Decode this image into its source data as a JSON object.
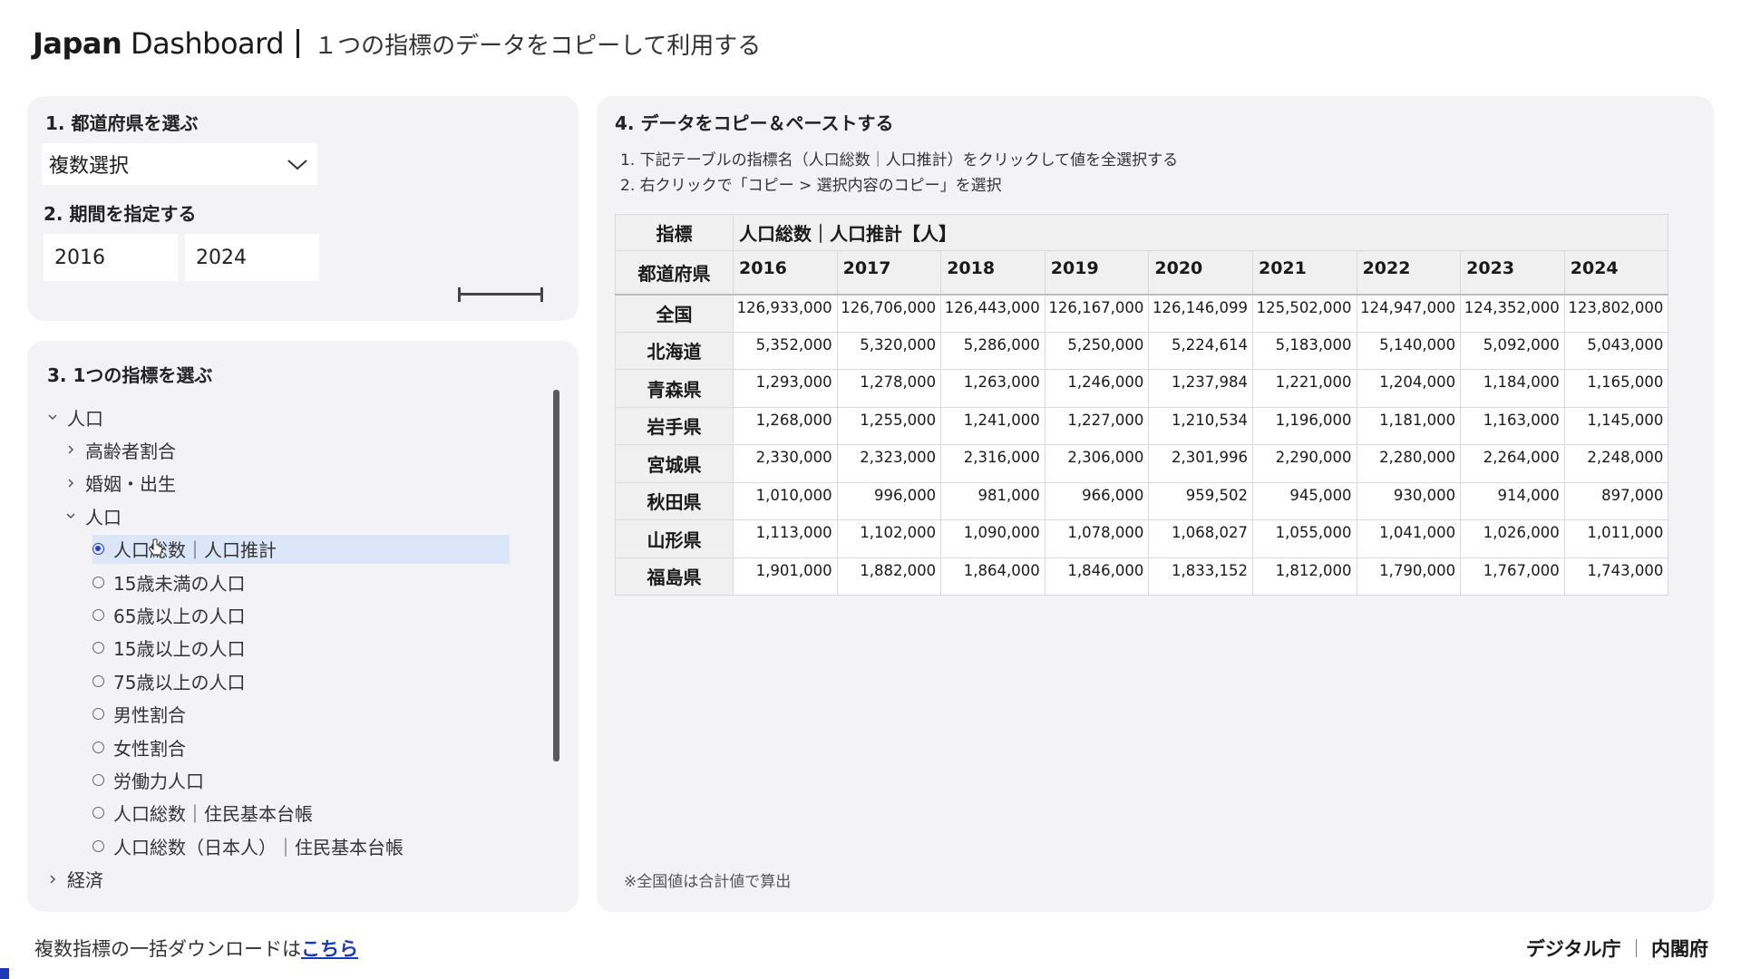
{
  "header": {
    "brand_bold": "Japan",
    "brand_light": " Dashboard",
    "subtitle": "１つの指標のデータをコピーして利用する"
  },
  "step1": {
    "title": "1. 都道府県を選ぶ",
    "select_value": "複数選択"
  },
  "step2": {
    "title": "2. 期間を指定する",
    "start_year": "2016",
    "end_year": "2024"
  },
  "step3": {
    "title": "3. 1つの指標を選ぶ",
    "tree": [
      {
        "label": "人口",
        "level": 0,
        "expanded": true,
        "type": "folder"
      },
      {
        "label": "高齢者割合",
        "level": 1,
        "expanded": false,
        "type": "folder"
      },
      {
        "label": "婚姻・出生",
        "level": 1,
        "expanded": false,
        "type": "folder"
      },
      {
        "label": "人口",
        "level": 1,
        "expanded": true,
        "type": "folder"
      },
      {
        "label": "人口総数｜人口推計",
        "level": 2,
        "type": "radio",
        "selected": true
      },
      {
        "label": "15歳未満の人口",
        "level": 2,
        "type": "radio",
        "selected": false
      },
      {
        "label": "65歳以上の人口",
        "level": 2,
        "type": "radio",
        "selected": false
      },
      {
        "label": "15歳以上の人口",
        "level": 2,
        "type": "radio",
        "selected": false
      },
      {
        "label": "75歳以上の人口",
        "level": 2,
        "type": "radio",
        "selected": false
      },
      {
        "label": "男性割合",
        "level": 2,
        "type": "radio",
        "selected": false
      },
      {
        "label": "女性割合",
        "level": 2,
        "type": "radio",
        "selected": false
      },
      {
        "label": "労働力人口",
        "level": 2,
        "type": "radio",
        "selected": false
      },
      {
        "label": "人口総数｜住民基本台帳",
        "level": 2,
        "type": "radio",
        "selected": false
      },
      {
        "label": "人口総数（日本人）｜住民基本台帳",
        "level": 2,
        "type": "radio",
        "selected": false
      },
      {
        "label": "経済",
        "level": 0,
        "expanded": false,
        "type": "folder"
      }
    ]
  },
  "step4": {
    "title": "4. データをコピー＆ペーストする",
    "instructions": [
      "1. 下記テーブルの指標名（人口総数｜人口推計）をクリックして値を全選択する",
      "2. 右クリックで「コピー > 選択内容のコピー」を選択"
    ],
    "table": {
      "indicator_label": "指標",
      "indicator_value": "人口総数｜人口推計【人】",
      "pref_label": "都道府県",
      "years": [
        "2016",
        "2017",
        "2018",
        "2019",
        "2020",
        "2021",
        "2022",
        "2023",
        "2024"
      ],
      "rows": [
        {
          "name": "全国",
          "values": [
            "126,933,000",
            "126,706,000",
            "126,443,000",
            "126,167,000",
            "126,146,099",
            "125,502,000",
            "124,947,000",
            "124,352,000",
            "123,802,000"
          ]
        },
        {
          "name": "北海道",
          "values": [
            "5,352,000",
            "5,320,000",
            "5,286,000",
            "5,250,000",
            "5,224,614",
            "5,183,000",
            "5,140,000",
            "5,092,000",
            "5,043,000"
          ]
        },
        {
          "name": "青森県",
          "values": [
            "1,293,000",
            "1,278,000",
            "1,263,000",
            "1,246,000",
            "1,237,984",
            "1,221,000",
            "1,204,000",
            "1,184,000",
            "1,165,000"
          ]
        },
        {
          "name": "岩手県",
          "values": [
            "1,268,000",
            "1,255,000",
            "1,241,000",
            "1,227,000",
            "1,210,534",
            "1,196,000",
            "1,181,000",
            "1,163,000",
            "1,145,000"
          ]
        },
        {
          "name": "宮城県",
          "values": [
            "2,330,000",
            "2,323,000",
            "2,316,000",
            "2,306,000",
            "2,301,996",
            "2,290,000",
            "2,280,000",
            "2,264,000",
            "2,248,000"
          ]
        },
        {
          "name": "秋田県",
          "values": [
            "1,010,000",
            "996,000",
            "981,000",
            "966,000",
            "959,502",
            "945,000",
            "930,000",
            "914,000",
            "897,000"
          ]
        },
        {
          "name": "山形県",
          "values": [
            "1,113,000",
            "1,102,000",
            "1,090,000",
            "1,078,000",
            "1,068,027",
            "1,055,000",
            "1,041,000",
            "1,026,000",
            "1,011,000"
          ]
        },
        {
          "name": "福島県",
          "values": [
            "1,901,000",
            "1,882,000",
            "1,864,000",
            "1,846,000",
            "1,833,152",
            "1,812,000",
            "1,790,000",
            "1,767,000",
            "1,743,000"
          ]
        }
      ]
    },
    "note": "※全国値は合計値で算出"
  },
  "footer": {
    "download_text": "複数指標の一括ダウンロードは",
    "download_link": "こちら",
    "org1": "デジタル庁",
    "org2": "内閣府"
  },
  "colors": {
    "accent": "#1f3bb3",
    "selected_bg": "#dce6f9",
    "panel_bg": "#f3f3f5"
  }
}
